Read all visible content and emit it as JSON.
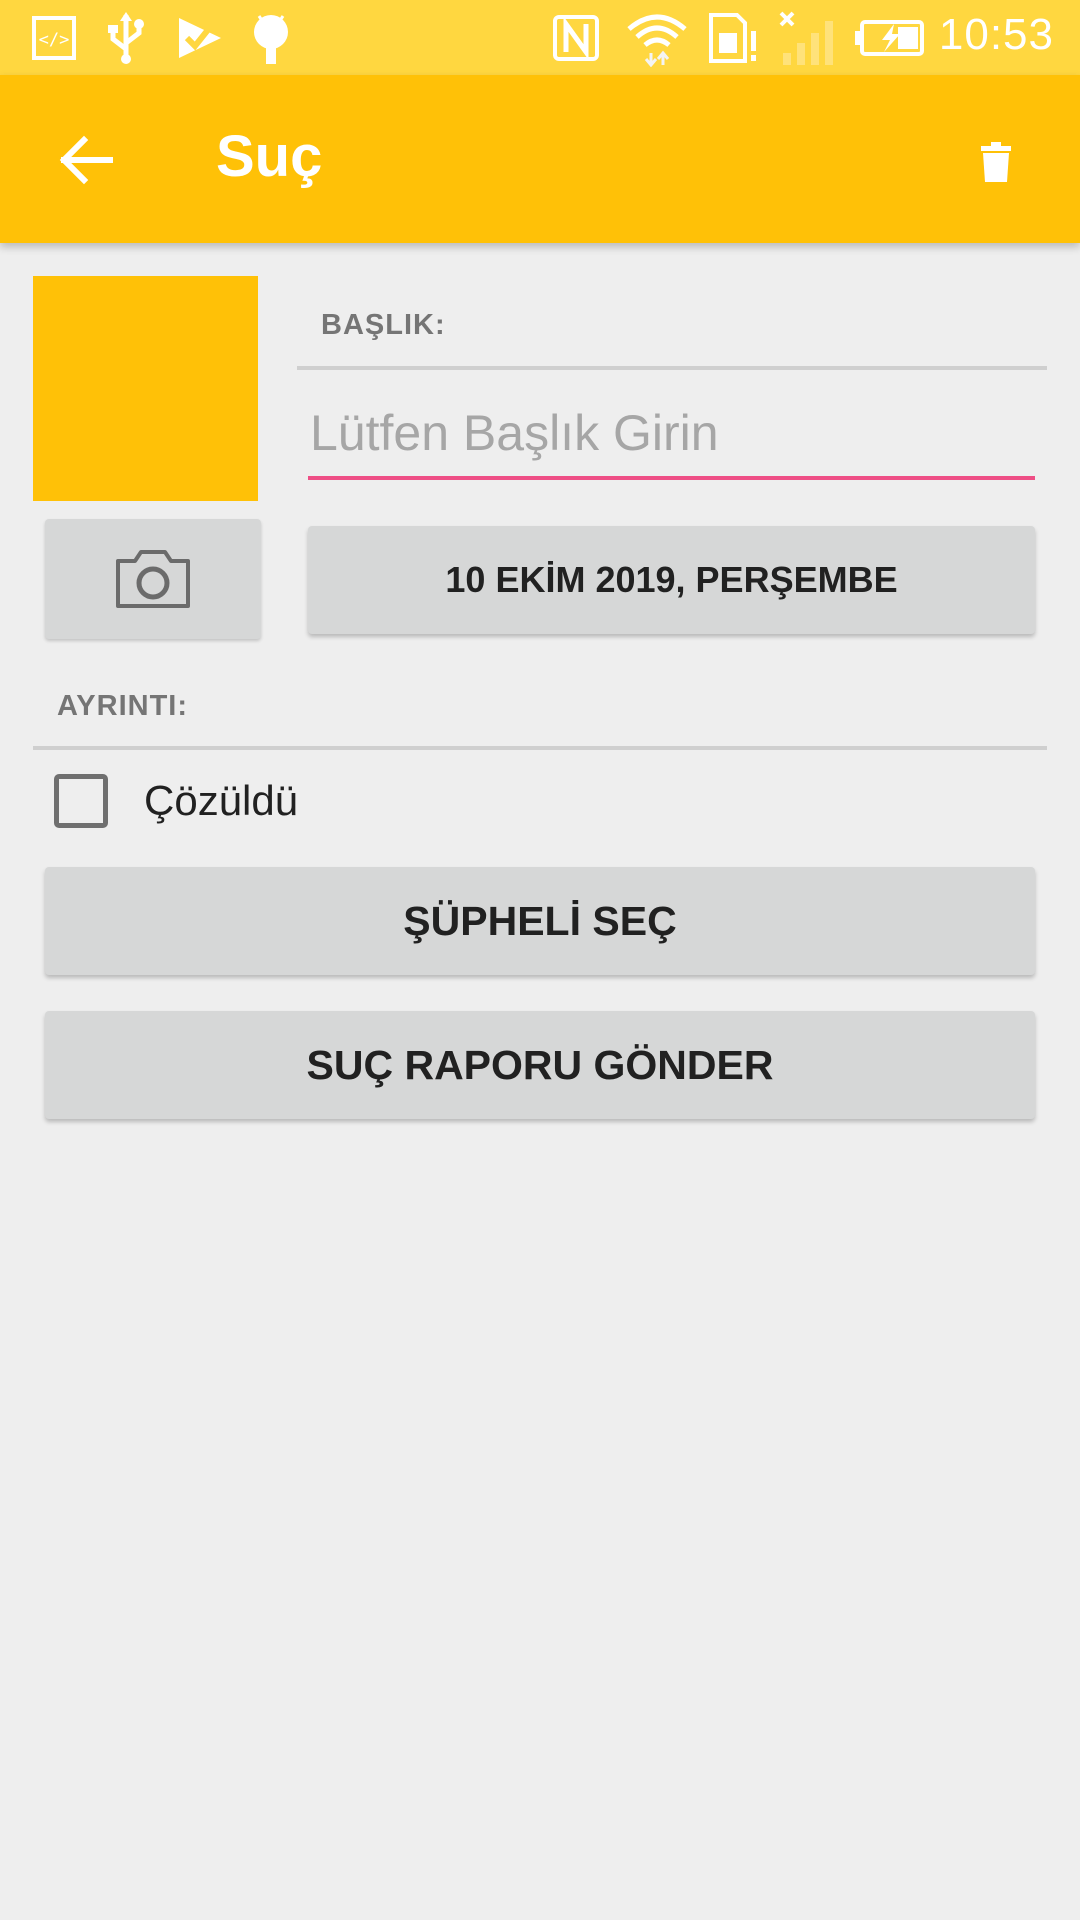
{
  "status_bar": {
    "time": "10:53",
    "icons": [
      "code-icon",
      "usb-icon",
      "check-notification-icon",
      "android-debug-icon",
      "nfc-icon",
      "wifi-icon",
      "sim-alert-icon",
      "signal-icon",
      "battery-charging-icon"
    ]
  },
  "app_bar": {
    "title": "Suç",
    "back_icon": "arrow-back-icon",
    "delete_icon": "trash-icon"
  },
  "photo": {
    "placeholder_color": "#ffc107",
    "camera_icon": "camera-icon"
  },
  "title_section": {
    "label": "BAŞLIK:",
    "input_value": "",
    "input_placeholder": "Lütfen Başlık Girin",
    "date_button": "10 EKİM 2019, PERŞEMBE"
  },
  "details_section": {
    "label": "AYRINTI:",
    "solved_checkbox_label": "Çözüldü",
    "solved_checked": false
  },
  "actions": {
    "choose_suspect": "ŞÜPHELİ SEÇ",
    "send_report": "SUÇ RAPORU GÖNDER"
  },
  "colors": {
    "status_bar": "#ffd740",
    "primary": "#ffc107",
    "accent": "#ee4e85",
    "background": "#eeeeee",
    "button": "#d6d7d7"
  }
}
